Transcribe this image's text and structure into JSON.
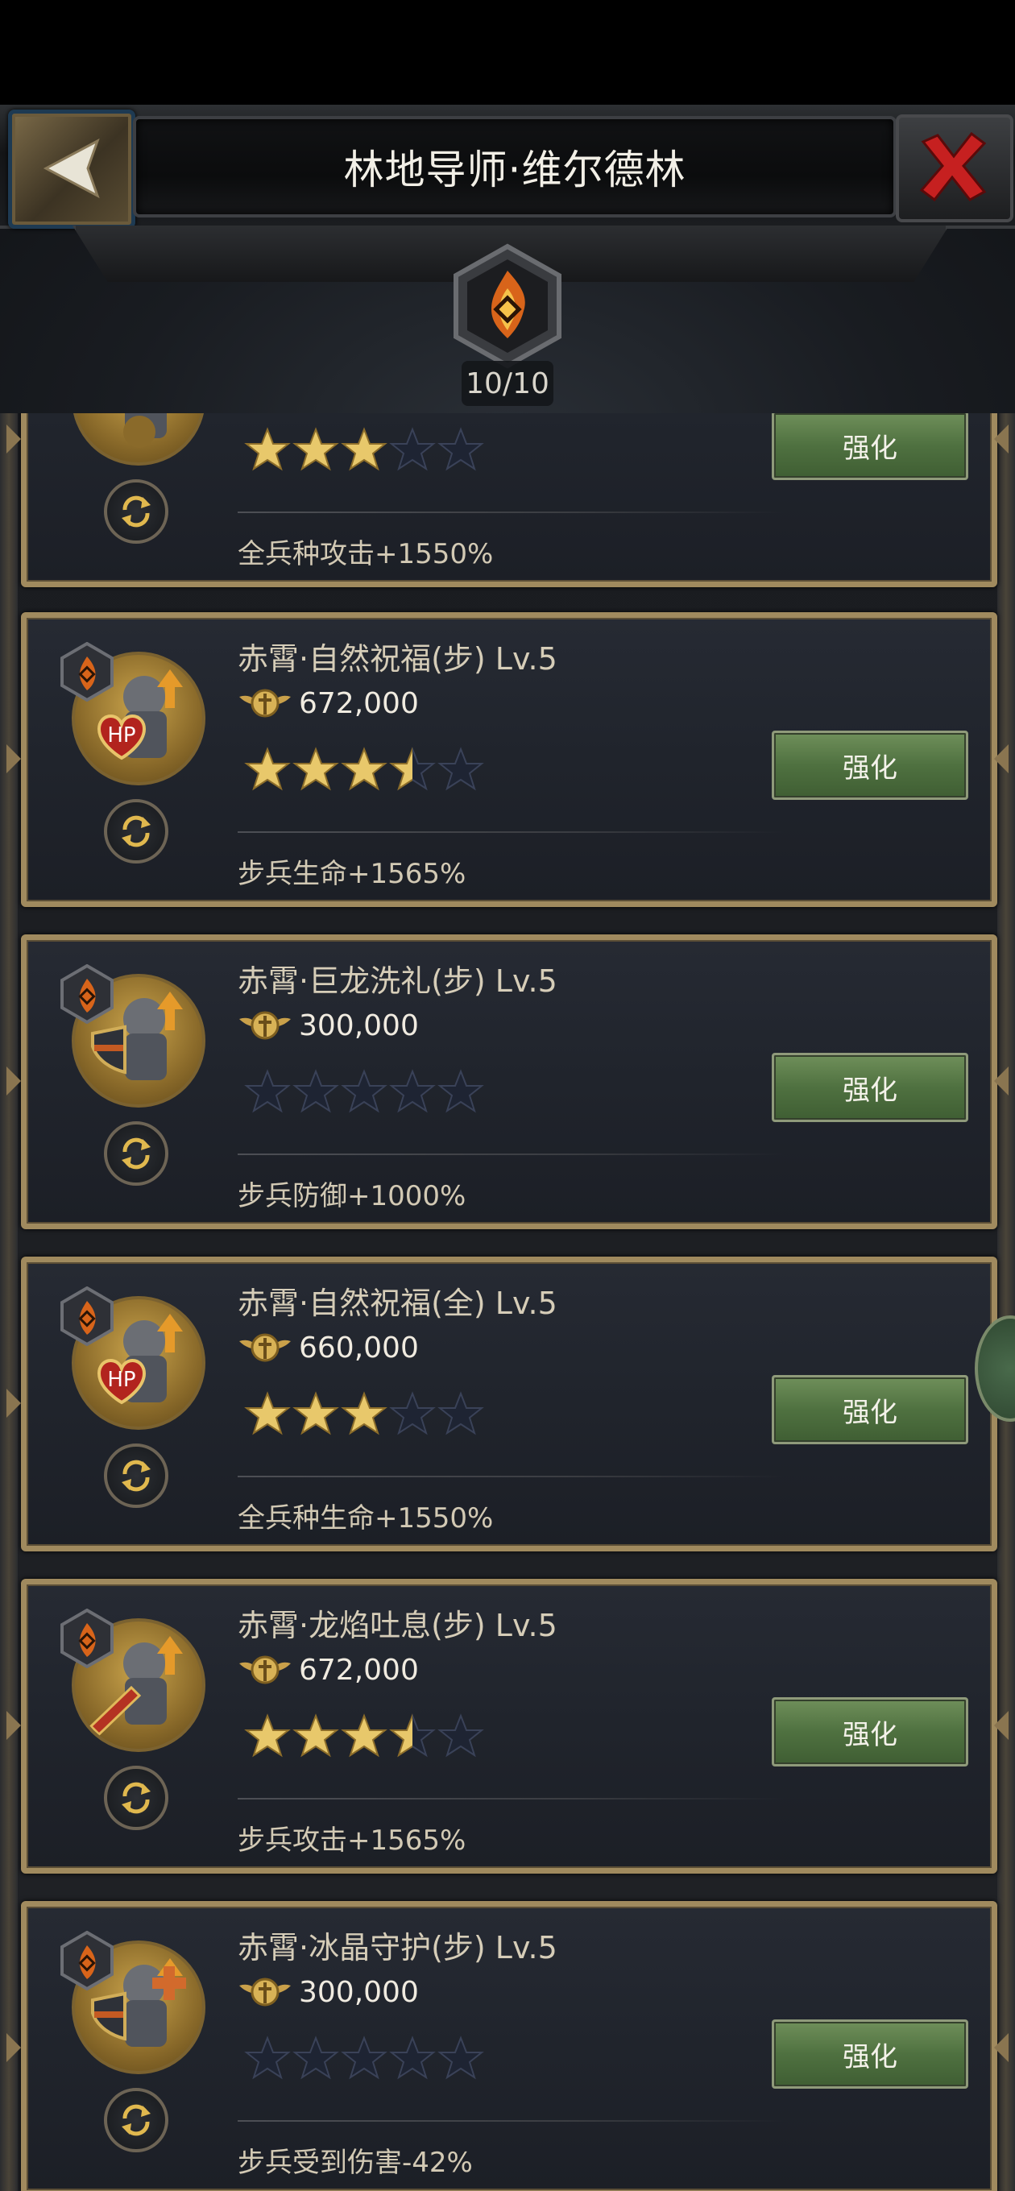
{
  "header": {
    "title": "林地导师·维尔德林",
    "progress_label": "10/10",
    "back_icon": "chevron-left-icon",
    "close_icon": "close-x-icon",
    "emblem_icon": "flame-rune-icon"
  },
  "colors": {
    "card_border": "#a08a5e",
    "button_green": "#4f7140",
    "star_gold": "#e8c86b",
    "star_empty": "#1e2433"
  },
  "cards": [
    {
      "name": "",
      "cost": "",
      "stars_filled": 3,
      "stars_half": false,
      "stars_total": 5,
      "button_label": "强化",
      "effect": "全兵种攻击+1550%",
      "portrait": "attack-warrior-portrait"
    },
    {
      "name": "赤霄·自然祝福(步) Lv.5",
      "cost": "672,000",
      "stars_filled": 3,
      "stars_half": true,
      "stars_total": 5,
      "button_label": "强化",
      "effect": "步兵生命+1565%",
      "portrait": "hp-heart-portrait"
    },
    {
      "name": "赤霄·巨龙洗礼(步) Lv.5",
      "cost": "300,000",
      "stars_filled": 0,
      "stars_half": false,
      "stars_total": 5,
      "button_label": "强化",
      "effect": "步兵防御+1000%",
      "portrait": "shield-portrait"
    },
    {
      "name": "赤霄·自然祝福(全) Lv.5",
      "cost": "660,000",
      "stars_filled": 3,
      "stars_half": false,
      "stars_total": 5,
      "button_label": "强化",
      "effect": "全兵种生命+1550%",
      "portrait": "hp-heart-portrait"
    },
    {
      "name": "赤霄·龙焰吐息(步) Lv.5",
      "cost": "672,000",
      "stars_filled": 3,
      "stars_half": true,
      "stars_total": 5,
      "button_label": "强化",
      "effect": "步兵攻击+1565%",
      "portrait": "sword-portrait"
    },
    {
      "name": "赤霄·冰晶守护(步) Lv.5",
      "cost": "300,000",
      "stars_filled": 0,
      "stars_half": false,
      "stars_total": 5,
      "button_label": "强化",
      "effect": "步兵受到伤害-42%",
      "portrait": "shield-cross-portrait"
    }
  ]
}
